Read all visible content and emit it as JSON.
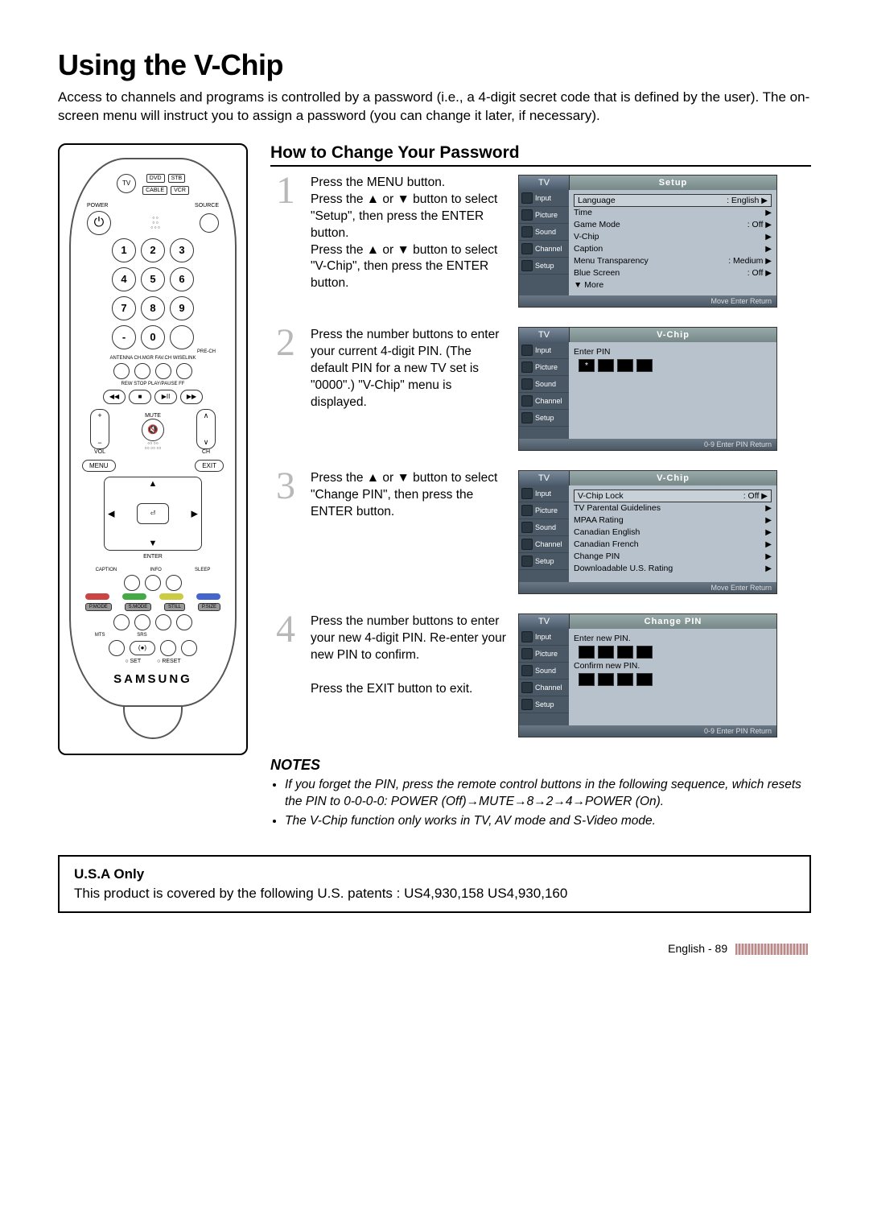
{
  "title": "Using the V-Chip",
  "intro": "Access to channels and programs is controlled by a password (i.e., a 4-digit secret code that is defined by the user). The on-screen menu will instruct you to assign a password (you can change it later, if necessary).",
  "remote": {
    "modes": [
      "DVD",
      "STB",
      "CABLE",
      "VCR"
    ],
    "tv": "TV",
    "power": "POWER",
    "source": "SOURCE",
    "nums": [
      "1",
      "2",
      "3",
      "4",
      "5",
      "6",
      "7",
      "8",
      "9",
      "-",
      "0",
      " "
    ],
    "prech": "PRE-CH",
    "row_labels": "ANTENNA CH.MGR  FAV.CH  WISELINK",
    "transport_labels": "REW   STOP   PLAY/PAUSE   FF",
    "transport": [
      "◀◀",
      "■",
      "▶II",
      "▶▶"
    ],
    "vol": "VOL",
    "ch": "CH",
    "mute": "MUTE",
    "menu": "MENU",
    "exit": "EXIT",
    "enter_icon": "⏎",
    "enter": "ENTER",
    "caption": "CAPTION",
    "info": "INFO",
    "sleep": "SLEEP",
    "row2": [
      "P.MODE",
      "S.MODE",
      "STILL",
      "P.SIZE"
    ],
    "row3": [
      "MTS",
      "SRS",
      "",
      ""
    ],
    "set": "SET",
    "reset": "RESET",
    "brand": "SAMSUNG"
  },
  "section_title": "How to Change Your Password",
  "steps": [
    {
      "num": "1",
      "text": "Press the MENU button.\nPress the ▲ or ▼ button to select \"Setup\", then press the ENTER button.\nPress the ▲ or ▼ button to select \"V-Chip\", then press the ENTER button.",
      "osd": {
        "tv": "TV",
        "title": "Setup",
        "side": [
          "Input",
          "Picture",
          "Sound",
          "Channel",
          "Setup"
        ],
        "rows": [
          {
            "k": "Language",
            "v": ": English",
            "boxed": true,
            "arr": "▶"
          },
          {
            "k": "Time",
            "v": "",
            "arr": "▶"
          },
          {
            "k": "Game Mode",
            "v": ": Off",
            "arr": "▶"
          },
          {
            "k": "V-Chip",
            "v": "",
            "arr": "▶"
          },
          {
            "k": "Caption",
            "v": "",
            "arr": "▶"
          },
          {
            "k": "Menu Transparency",
            "v": ": Medium",
            "arr": "▶"
          },
          {
            "k": "Blue Screen",
            "v": ": Off",
            "arr": "▶"
          },
          {
            "k": "▼ More",
            "v": "",
            "arr": ""
          }
        ],
        "foot": "Move      Enter      Return"
      }
    },
    {
      "num": "2",
      "text": "Press the number buttons to enter your current 4-digit PIN. (The default PIN for a new TV set is \"0000\".) \"V-Chip\" menu is displayed.",
      "osd": {
        "tv": "TV",
        "title": "V-Chip",
        "side": [
          "Input",
          "Picture",
          "Sound",
          "Channel",
          "Setup"
        ],
        "pin_label": "Enter PIN",
        "pin_star": true,
        "foot": "0-9 Enter PIN            Return"
      }
    },
    {
      "num": "3",
      "text": "Press the ▲ or ▼ button to select \"Change PIN\", then press the ENTER button.",
      "osd": {
        "tv": "TV",
        "title": "V-Chip",
        "side": [
          "Input",
          "Picture",
          "Sound",
          "Channel",
          "Setup"
        ],
        "rows": [
          {
            "k": "V-Chip Lock",
            "v": ": Off",
            "boxed": true,
            "arr": "▶"
          },
          {
            "k": "TV Parental Guidelines",
            "v": "",
            "arr": "▶"
          },
          {
            "k": "MPAA Rating",
            "v": "",
            "arr": "▶"
          },
          {
            "k": "Canadian English",
            "v": "",
            "arr": "▶"
          },
          {
            "k": "Canadian French",
            "v": "",
            "arr": "▶"
          },
          {
            "k": "Change PIN",
            "v": "",
            "arr": "▶"
          },
          {
            "k": "Downloadable U.S. Rating",
            "v": "",
            "arr": "▶"
          }
        ],
        "foot": "Move      Enter      Return"
      }
    },
    {
      "num": "4",
      "text": "Press the number buttons to enter your new 4-digit PIN. Re-enter your new PIN to confirm.\n\nPress the EXIT button to exit.",
      "osd": {
        "tv": "TV",
        "title": "Change PIN",
        "side": [
          "Input",
          "Picture",
          "Sound",
          "Channel",
          "Setup"
        ],
        "pin_label": "Enter new PIN.",
        "pin2_label": "Confirm new PIN.",
        "foot": "0-9 Enter PIN            Return"
      }
    }
  ],
  "notes_h": "NOTES",
  "notes": [
    "If you forget the PIN, press the remote control buttons in the following sequence, which resets the PIN to 0-0-0-0: POWER (Off)→MUTE→8→2→4→POWER (On).",
    "The V-Chip function only works in TV, AV mode and S-Video mode."
  ],
  "usa": {
    "h": "U.S.A Only",
    "body": "This product is covered by the following U.S. patents : US4,930,158 US4,930,160"
  },
  "footer": "English - 89"
}
